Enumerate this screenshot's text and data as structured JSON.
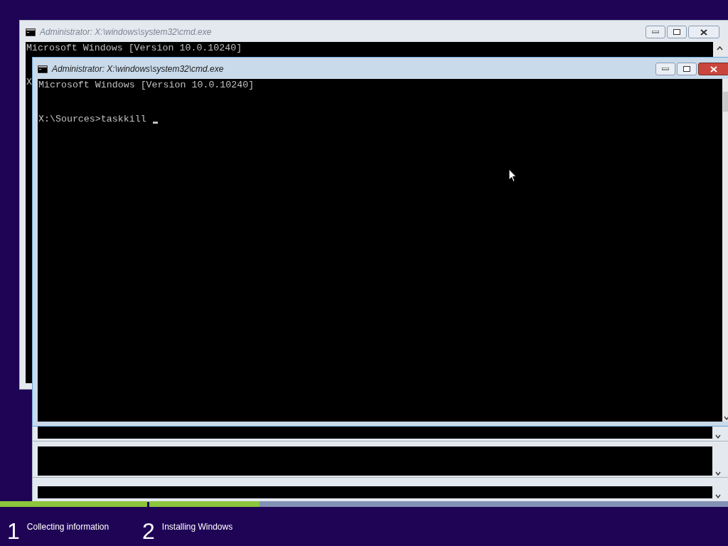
{
  "back_window": {
    "title": "Administrator: X:\\windows\\system32\\cmd.exe",
    "lines": [
      "Microsoft Windows [Version 10.0.10240]",
      "X"
    ]
  },
  "front_window": {
    "title": "Administrator: X:\\windows\\system32\\cmd.exe",
    "lines": [
      "Microsoft Windows [Version 10.0.10240]"
    ],
    "prompt": "X:\\Sources>taskkill"
  },
  "progress": [
    {
      "level": 1
    },
    {
      "level": 0.19
    }
  ],
  "steps": [
    {
      "number": "1",
      "label": "Collecting information"
    },
    {
      "number": "2",
      "label": "Installing Windows"
    }
  ]
}
